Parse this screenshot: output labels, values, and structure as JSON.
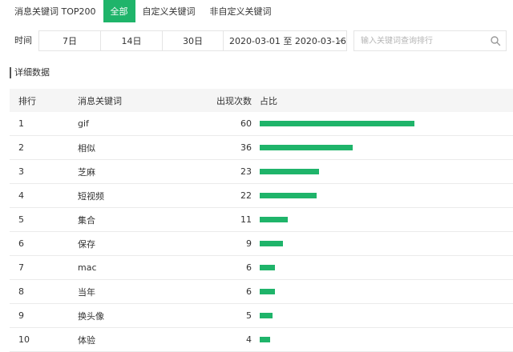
{
  "tabs": [
    "消息关键词 TOP200",
    "全部",
    "自定义关键词",
    "非自定义关键词"
  ],
  "active_tab": 1,
  "filter": {
    "label": "时间",
    "periods": [
      "7日",
      "14日",
      "30日"
    ],
    "date_range": "2020-03-01 至 2020-03-16",
    "search_placeholder": "输入关键词查询排行"
  },
  "section_title": "详细数据",
  "table": {
    "headers": {
      "rank": "排行",
      "keyword": "消息关键词",
      "count": "出现次数",
      "ratio": "占比"
    },
    "max_count": 60,
    "rows": [
      {
        "rank": "1",
        "keyword": "gif",
        "count": "60"
      },
      {
        "rank": "2",
        "keyword": "相似",
        "count": "36"
      },
      {
        "rank": "3",
        "keyword": "芝麻",
        "count": "23"
      },
      {
        "rank": "4",
        "keyword": "短视频",
        "count": "22"
      },
      {
        "rank": "5",
        "keyword": "集合",
        "count": "11"
      },
      {
        "rank": "6",
        "keyword": "保存",
        "count": "9"
      },
      {
        "rank": "7",
        "keyword": "mac",
        "count": "6"
      },
      {
        "rank": "8",
        "keyword": "当年",
        "count": "6"
      },
      {
        "rank": "9",
        "keyword": "换头像",
        "count": "5"
      },
      {
        "rank": "10",
        "keyword": "体验",
        "count": "4"
      }
    ]
  },
  "colors": {
    "accent": "#1fb46a",
    "header_bg": "#f5f5f5",
    "border": "#e4e4e4"
  },
  "icons": {
    "search": "search-icon",
    "dropdown": "caret-down-icon"
  }
}
